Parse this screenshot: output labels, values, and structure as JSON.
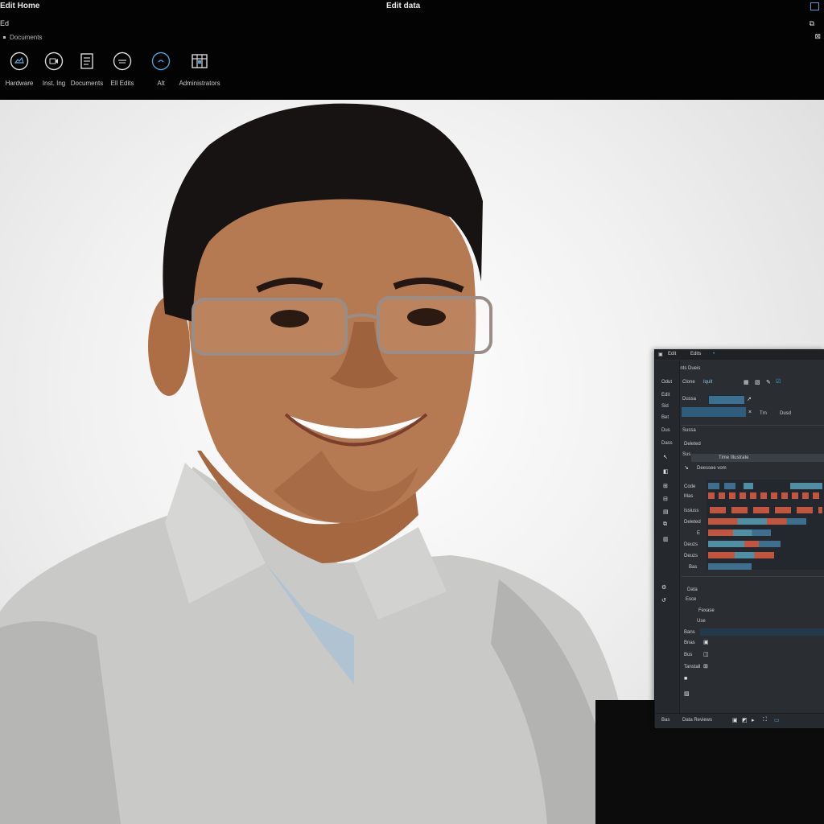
{
  "app": {
    "title": "Edit Home",
    "window_title": "Edit data",
    "menu_label": "Ed",
    "sub_label": "Documents"
  },
  "toolbar": {
    "items": [
      {
        "label": "Hardware",
        "icon": "gallery-circle-icon"
      },
      {
        "label": "Inst. Ing",
        "icon": "video-circle-icon"
      },
      {
        "label": "Documents",
        "icon": "document-list-icon"
      },
      {
        "label": "Ell Edits",
        "icon": "profile-circle-icon"
      },
      {
        "label": "Alt",
        "icon": "circle-target-icon"
      },
      {
        "label": "Administrators",
        "icon": "grid-calendar-icon"
      }
    ]
  },
  "photo": {
    "subject": "portrait-photo",
    "colors": {
      "background": "#f2f2f2",
      "skin": "#b67a52",
      "hair": "#171312",
      "shirt": "#c9c9c7",
      "shirt_shadow": "#a9abaa"
    }
  },
  "panel": {
    "header": [
      "Edit",
      "Edits"
    ],
    "heading": "Documents Dueis",
    "sidebar_labels": [
      "Odut",
      "Edit",
      "Sid",
      "Bet",
      "Dus",
      "Dass"
    ],
    "field_label": "Clone",
    "input_value": "Iquit",
    "search_label": "Dussa",
    "tab_label": "Trn",
    "search_tag": "Dusd",
    "section_1": "Sussa",
    "section_2": "Deleted",
    "section_3": "Sus",
    "timeline_title": "Time Illustrate",
    "timeline_sub": "Deessee vom",
    "track_labels": [
      "Code",
      "Mas",
      "Issiuss",
      "Deleted",
      "E",
      "Deuzs",
      "Deuzs",
      "Bas"
    ],
    "lower_labels": [
      "Data",
      "Esce",
      "Fexase",
      "Use",
      "Bans",
      "Bnas",
      "Bus",
      "Tanstall"
    ],
    "footer_items": [
      "Bas",
      "Data Reviews"
    ],
    "colors": {
      "bg": "#2a2e33",
      "accent": "#3d8fc9",
      "bar_red": "#c2553f",
      "bar_blue": "#3f6f8f",
      "bar_teal": "#4f8ea3"
    }
  }
}
